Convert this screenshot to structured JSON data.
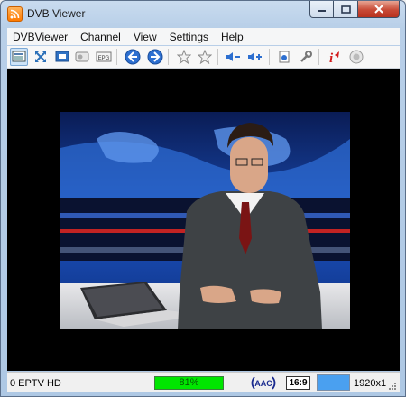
{
  "window": {
    "title": "DVB Viewer"
  },
  "menu": [
    "DVBViewer",
    "Channel",
    "View",
    "Settings",
    "Help"
  ],
  "toolbar": {
    "icons": [
      "window-mode-icon",
      "fullscreen-icon",
      "tv-icon",
      "radio-icon",
      "epg-icon",
      "back-icon",
      "forward-icon",
      "favorite-icon",
      "favorite-add-icon",
      "volume-down-icon",
      "volume-up-icon",
      "record-icon",
      "settings-icon",
      "info-icon",
      "stop-icon"
    ]
  },
  "status": {
    "channel": "0 EPTV HD",
    "signal": "81%",
    "signal_level": 0.81,
    "audio": "AAC",
    "ratio": "16:9",
    "resolution": "1920x1"
  },
  "colors": {
    "accent": "#4aa0f0",
    "signal": "#00e600",
    "close": "#c84a36"
  }
}
